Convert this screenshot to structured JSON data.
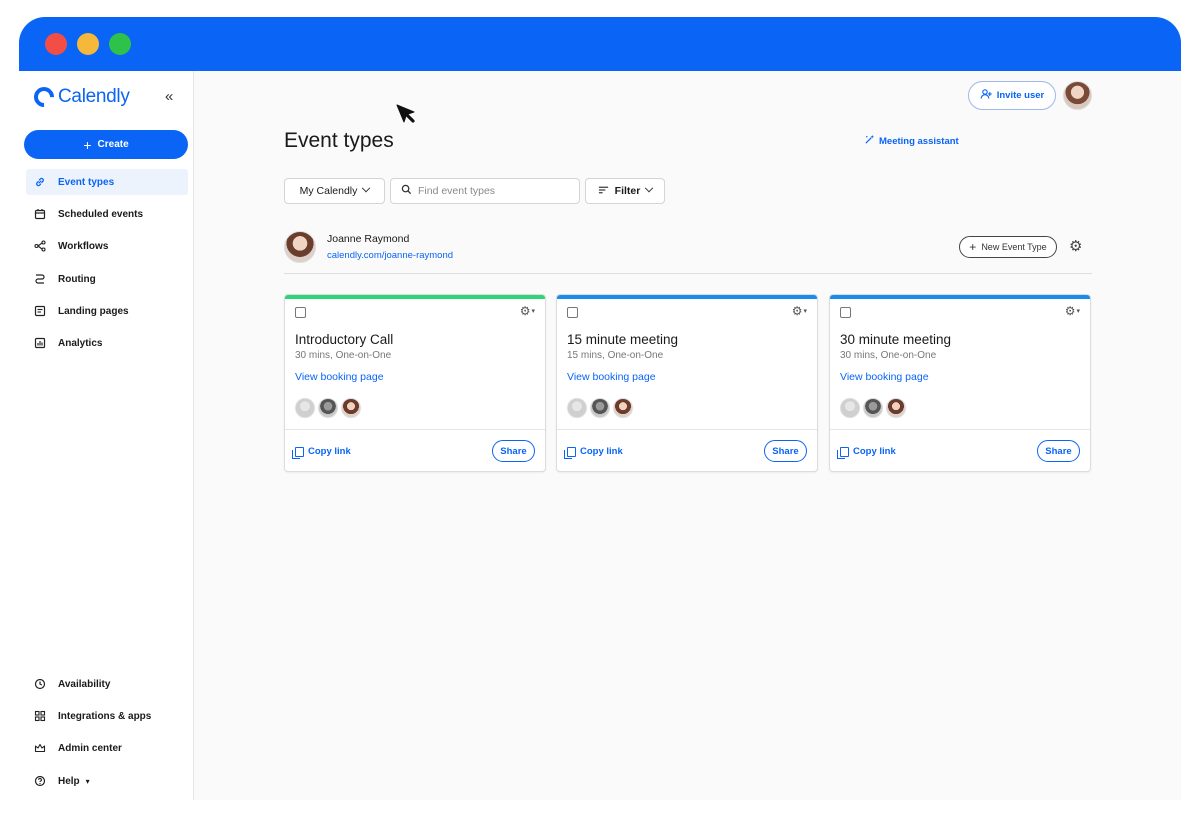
{
  "app": {
    "name": "Calendly"
  },
  "sidebar": {
    "create_label": "Create",
    "items": [
      {
        "label": "Event types",
        "icon": "link-icon",
        "active": true
      },
      {
        "label": "Scheduled events",
        "icon": "calendar-icon"
      },
      {
        "label": "Workflows",
        "icon": "workflow-icon"
      },
      {
        "label": "Routing",
        "icon": "routing-icon"
      },
      {
        "label": "Landing pages",
        "icon": "landing-page-icon"
      },
      {
        "label": "Analytics",
        "icon": "analytics-icon"
      }
    ],
    "bottom_items": [
      {
        "label": "Availability",
        "icon": "clock-icon"
      },
      {
        "label": "Integrations & apps",
        "icon": "grid-icon"
      },
      {
        "label": "Admin center",
        "icon": "crown-icon"
      },
      {
        "label": "Help",
        "icon": "help-icon"
      }
    ]
  },
  "header": {
    "invite_label": "Invite user",
    "page_title": "Event types",
    "assistant_label": "Meeting assistant"
  },
  "filters": {
    "calendar_select": "My Calendly",
    "search_placeholder": "Find event types",
    "filter_label": "Filter"
  },
  "user": {
    "name": "Joanne Raymond",
    "link": "calendly.com/joanne-raymond",
    "new_event_label": "New Event Type"
  },
  "cards": [
    {
      "title": "Introductory Call",
      "subtitle": "30 mins, One-on-One",
      "view_label": "View booking page",
      "copy_label": "Copy link",
      "share_label": "Share",
      "color": "#2ed37a"
    },
    {
      "title": "15 minute meeting",
      "subtitle": "15 mins, One-on-One",
      "view_label": "View booking page",
      "copy_label": "Copy link",
      "share_label": "Share",
      "color": "#1a8cf0"
    },
    {
      "title": "30 minute meeting",
      "subtitle": "30 mins, One-on-One",
      "view_label": "View booking page",
      "copy_label": "Copy link",
      "share_label": "Share",
      "color": "#1a8cf0"
    }
  ],
  "colors": {
    "brand": "#0a64f5",
    "titlebar": "#0a64f5"
  }
}
